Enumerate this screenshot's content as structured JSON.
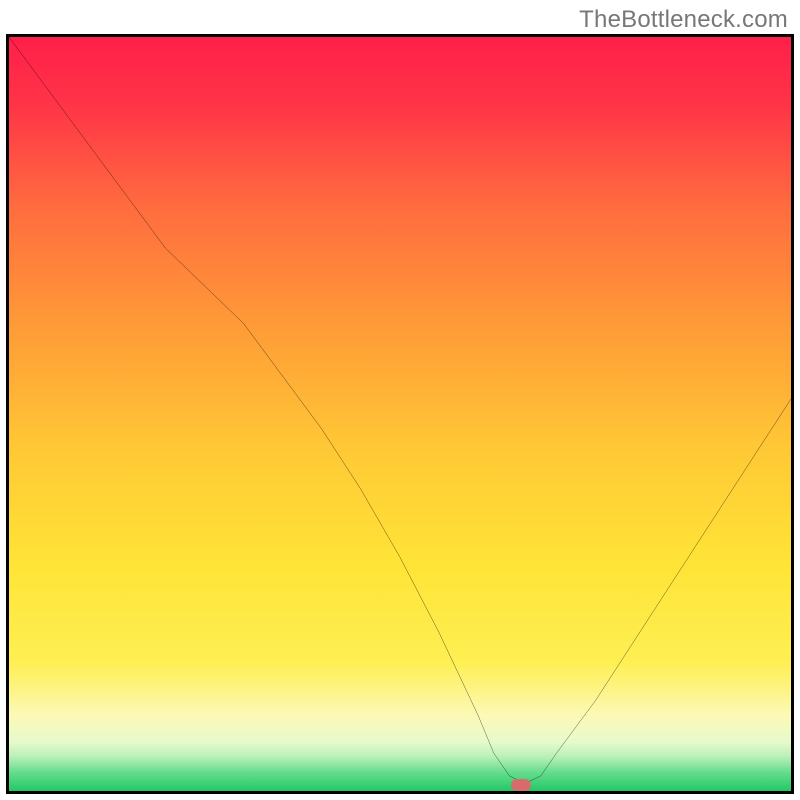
{
  "watermark": "TheBottleneck.com",
  "colors": {
    "grad_top": "#ff1f4a",
    "grad_mid_orange": "#ffa935",
    "grad_mid_yellow": "#ffe437",
    "grad_pale_yellow": "#fcfac0",
    "grad_pale_green": "#c5f7c3",
    "grad_green": "#2bd16a",
    "curve": "#000000",
    "marker": "#d86b6b",
    "frame": "#000000"
  },
  "chart_data": {
    "type": "line",
    "title": "",
    "xlabel": "",
    "ylabel": "",
    "xlim": [
      0,
      100
    ],
    "ylim": [
      0,
      100
    ],
    "series": [
      {
        "name": "bottleneck-curve",
        "x": [
          0,
          5,
          10,
          15,
          20,
          25,
          30,
          35,
          40,
          45,
          50,
          55,
          60,
          62,
          64,
          66,
          68,
          70,
          75,
          80,
          85,
          90,
          95,
          100
        ],
        "y": [
          100,
          93,
          86,
          79,
          72,
          67,
          62,
          55,
          48,
          40,
          31,
          21,
          10,
          5,
          2,
          1,
          2,
          5,
          12,
          20,
          28,
          36,
          44,
          52
        ]
      }
    ],
    "marker": {
      "x": 65.5,
      "y": 0.5,
      "color": "#d86b6b"
    }
  }
}
